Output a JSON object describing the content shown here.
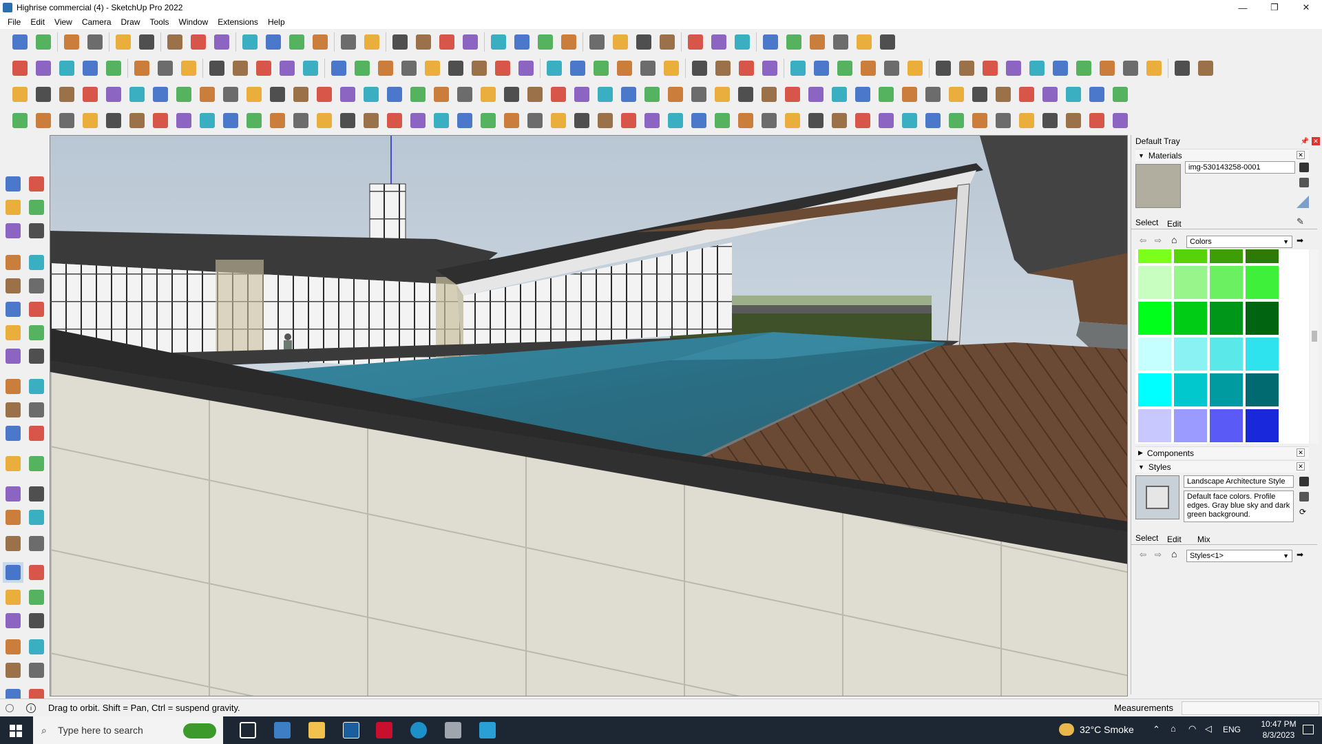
{
  "window": {
    "title": "Highrise commercial (4) - SketchUp Pro 2022",
    "minimize": "—",
    "maximize": "❐",
    "close": "✕"
  },
  "menu": [
    "File",
    "Edit",
    "View",
    "Camera",
    "Draw",
    "Tools",
    "Window",
    "Extensions",
    "Help"
  ],
  "tray": {
    "title": "Default Tray",
    "materials": {
      "header": "Materials",
      "name_value": "img-530143258-0001",
      "select_tab": "Select",
      "edit_tab": "Edit",
      "library": "Colors",
      "swatches": [
        [
          "#7cff1a",
          "#58d30a",
          "#3d9e08",
          "#2d7a06"
        ],
        [
          "#c8ffc0",
          "#98f58c",
          "#6af060",
          "#3ef03a"
        ],
        [
          "#00ff1a",
          "#00cc16",
          "#00961a",
          "#006410"
        ],
        [
          "#c6ffff",
          "#8af2f2",
          "#5ae8e8",
          "#2ee2ee"
        ],
        [
          "#00ffff",
          "#00c8cc",
          "#009ba0",
          "#006a70"
        ],
        [
          "#c8c8ff",
          "#9a9aff",
          "#5a5af6",
          "#1a28dc"
        ]
      ]
    },
    "components": {
      "header": "Components"
    },
    "styles": {
      "header": "Styles",
      "style_name": "Landscape Architecture Style",
      "style_desc": "Default face colors. Profile edges. Gray blue sky and dark green background.",
      "select_tab": "Select",
      "edit_tab": "Edit",
      "mix_tab": "Mix",
      "collection": "Styles<1>"
    }
  },
  "status": {
    "hint": "Drag to orbit. Shift = Pan, Ctrl = suspend gravity.",
    "measurements_label": "Measurements",
    "measurements_value": ""
  },
  "taskbar": {
    "search_placeholder": "Type here to search",
    "weather": "32°C  Smoke",
    "language": "ENG",
    "time": "10:47 PM",
    "date": "8/3/2023"
  }
}
